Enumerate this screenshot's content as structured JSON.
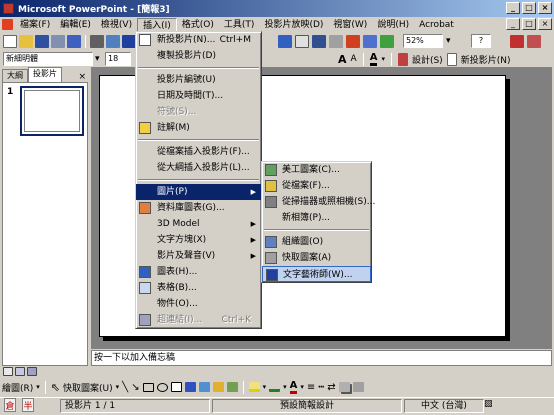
{
  "window": {
    "title": "Microsoft PowerPoint - [簡報3]",
    "controls": [
      "_",
      "□",
      "×"
    ],
    "doc_controls": [
      "_",
      "□",
      "×"
    ]
  },
  "menubar": [
    "檔案(F)",
    "編輯(E)",
    "檢視(V)",
    "插入(I)",
    "格式(O)",
    "工具(T)",
    "投影片放映(D)",
    "視窗(W)",
    "說明(H)",
    "Acrobat"
  ],
  "toolbar": {
    "zoom": "52%",
    "help_btn": "?",
    "font_name": "新細明體",
    "font_size": "18",
    "design_label": "設計(S)",
    "new_slide_label": "新投影片(N)"
  },
  "panel": {
    "tabs": [
      "大綱",
      "投影片"
    ],
    "close": "×",
    "slide_number": "1"
  },
  "notes": {
    "placeholder": "按一下以加入備忘稿"
  },
  "drawbar": {
    "draw_label": "繪圖(R)",
    "autoshapes_label": "快取圖案(U)"
  },
  "statusbar": {
    "slide_info": "投影片 1 / 1",
    "design_name": "預設簡報設計",
    "language": "中文 (台灣)"
  },
  "insert_menu": {
    "items": [
      {
        "label": "新投影片(N)...",
        "shortcut": "Ctrl+M",
        "icon": "new-slide-icon"
      },
      {
        "label": "複製投影片(D)"
      },
      {
        "sep": true
      },
      {
        "label": "投影片編號(U)"
      },
      {
        "label": "日期及時間(T)..."
      },
      {
        "label": "符號(S)...",
        "disabled": true
      },
      {
        "label": "註解(M)",
        "icon": "comment-icon"
      },
      {
        "sep": true
      },
      {
        "label": "從檔案插入投影片(F)..."
      },
      {
        "label": "從大綱插入投影片(L)..."
      },
      {
        "sep": true
      },
      {
        "label": "圖片(P)",
        "arrow": true,
        "highlight": true
      },
      {
        "label": "資料庫圖表(G)...",
        "icon": "diagram-icon"
      },
      {
        "label": "3D Model",
        "arrow": true
      },
      {
        "label": "文字方塊(X)",
        "arrow": true
      },
      {
        "label": "影片及聲音(V)",
        "arrow": true
      },
      {
        "label": "圖表(H)...",
        "icon": "chart-icon"
      },
      {
        "label": "表格(B)...",
        "icon": "table-icon"
      },
      {
        "label": "物件(O)..."
      },
      {
        "label": "超連結(I)...",
        "shortcut": "Ctrl+K",
        "disabled": true,
        "icon": "hyperlink-icon"
      }
    ]
  },
  "picture_submenu": {
    "items": [
      {
        "label": "美工圖案(C)...",
        "icon": "clipart-icon"
      },
      {
        "label": "從檔案(F)...",
        "icon": "from-file-icon"
      },
      {
        "label": "從掃描器或照相機(S)...",
        "icon": "scanner-icon"
      },
      {
        "label": "新相簿(P)..."
      },
      {
        "sep": true
      },
      {
        "label": "組織圖(O)",
        "icon": "org-chart-icon"
      },
      {
        "label": "快取圖案(A)",
        "icon": "autoshapes-icon"
      },
      {
        "label": "文字藝術師(W)...",
        "icon": "wordart-icon",
        "highlight": true
      }
    ]
  }
}
